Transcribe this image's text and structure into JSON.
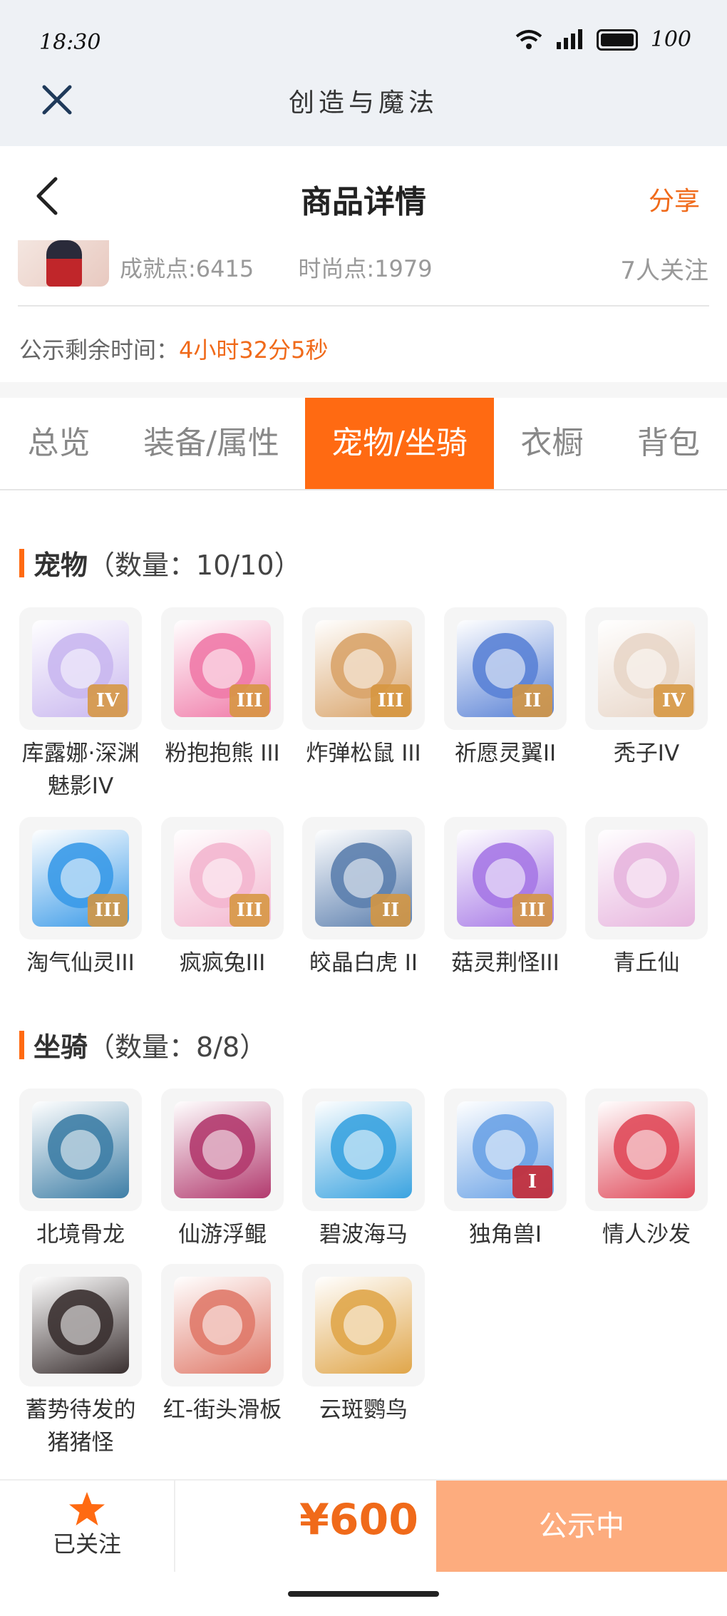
{
  "status_bar": {
    "time": "18:30",
    "battery": "100"
  },
  "webview": {
    "title": "创造与魔法"
  },
  "navbar": {
    "title": "商品详情",
    "share": "分享"
  },
  "summary": {
    "achievement": "成就点:6415",
    "fashion": "时尚点:1979",
    "followers": "7人关注",
    "notice_label": "公示剩余时间：",
    "notice_countdown": "4小时32分5秒"
  },
  "tabs": [
    {
      "label": "总览",
      "active": false
    },
    {
      "label": "装备/属性",
      "active": false
    },
    {
      "label": "宠物/坐骑",
      "active": true
    },
    {
      "label": "衣橱",
      "active": false
    },
    {
      "label": "背包",
      "active": false
    }
  ],
  "pets": {
    "title": "宠物",
    "count": "（数量：10/10）",
    "items": [
      {
        "name": "库露娜·深渊魅影IV",
        "badge": "IV",
        "color": "#c9b7ef"
      },
      {
        "name": "粉抱抱熊 III",
        "badge": "III",
        "color": "#f07aa8"
      },
      {
        "name": "炸弹松鼠 III",
        "badge": "III",
        "color": "#d9a46a"
      },
      {
        "name": "祈愿灵翼II",
        "badge": "II",
        "color": "#5a82d6"
      },
      {
        "name": "秃子IV",
        "badge": "IV",
        "color": "#e8d6c8"
      },
      {
        "name": "淘气仙灵III",
        "badge": "III",
        "color": "#3a9ae8"
      },
      {
        "name": "疯疯兔III",
        "badge": "III",
        "color": "#f3b6cf"
      },
      {
        "name": "皎晶白虎 II",
        "badge": "II",
        "color": "#5c7fae"
      },
      {
        "name": "菇灵荆怪III",
        "badge": "III",
        "color": "#a678e6"
      },
      {
        "name": "青丘仙",
        "badge": "",
        "color": "#e7b5de"
      }
    ]
  },
  "mounts": {
    "title": "坐骑",
    "count": "（数量：8/8）",
    "items": [
      {
        "name": "北境骨龙",
        "badge": "",
        "color": "#3e7ea6"
      },
      {
        "name": "仙游浮鲲",
        "badge": "",
        "color": "#b23a6e"
      },
      {
        "name": "碧波海马",
        "badge": "",
        "color": "#3aa3e0"
      },
      {
        "name": "独角兽I",
        "badge": "I",
        "color": "#6aa2e6"
      },
      {
        "name": "情人沙发",
        "badge": "",
        "color": "#e04a5a"
      },
      {
        "name": "蓄势待发的猪猪怪",
        "badge": "",
        "color": "#3a3030"
      },
      {
        "name": "红-街头滑板",
        "badge": "",
        "color": "#e07a6a"
      },
      {
        "name": "云斑鹦鸟",
        "badge": "",
        "color": "#e0a64a"
      }
    ]
  },
  "bottom": {
    "follow_label": "已关注",
    "price": "¥600",
    "status": "公示中"
  },
  "colors": {
    "accent": "#ff6a12",
    "price": "#f06a1a",
    "status_button": "#fdac7e"
  }
}
